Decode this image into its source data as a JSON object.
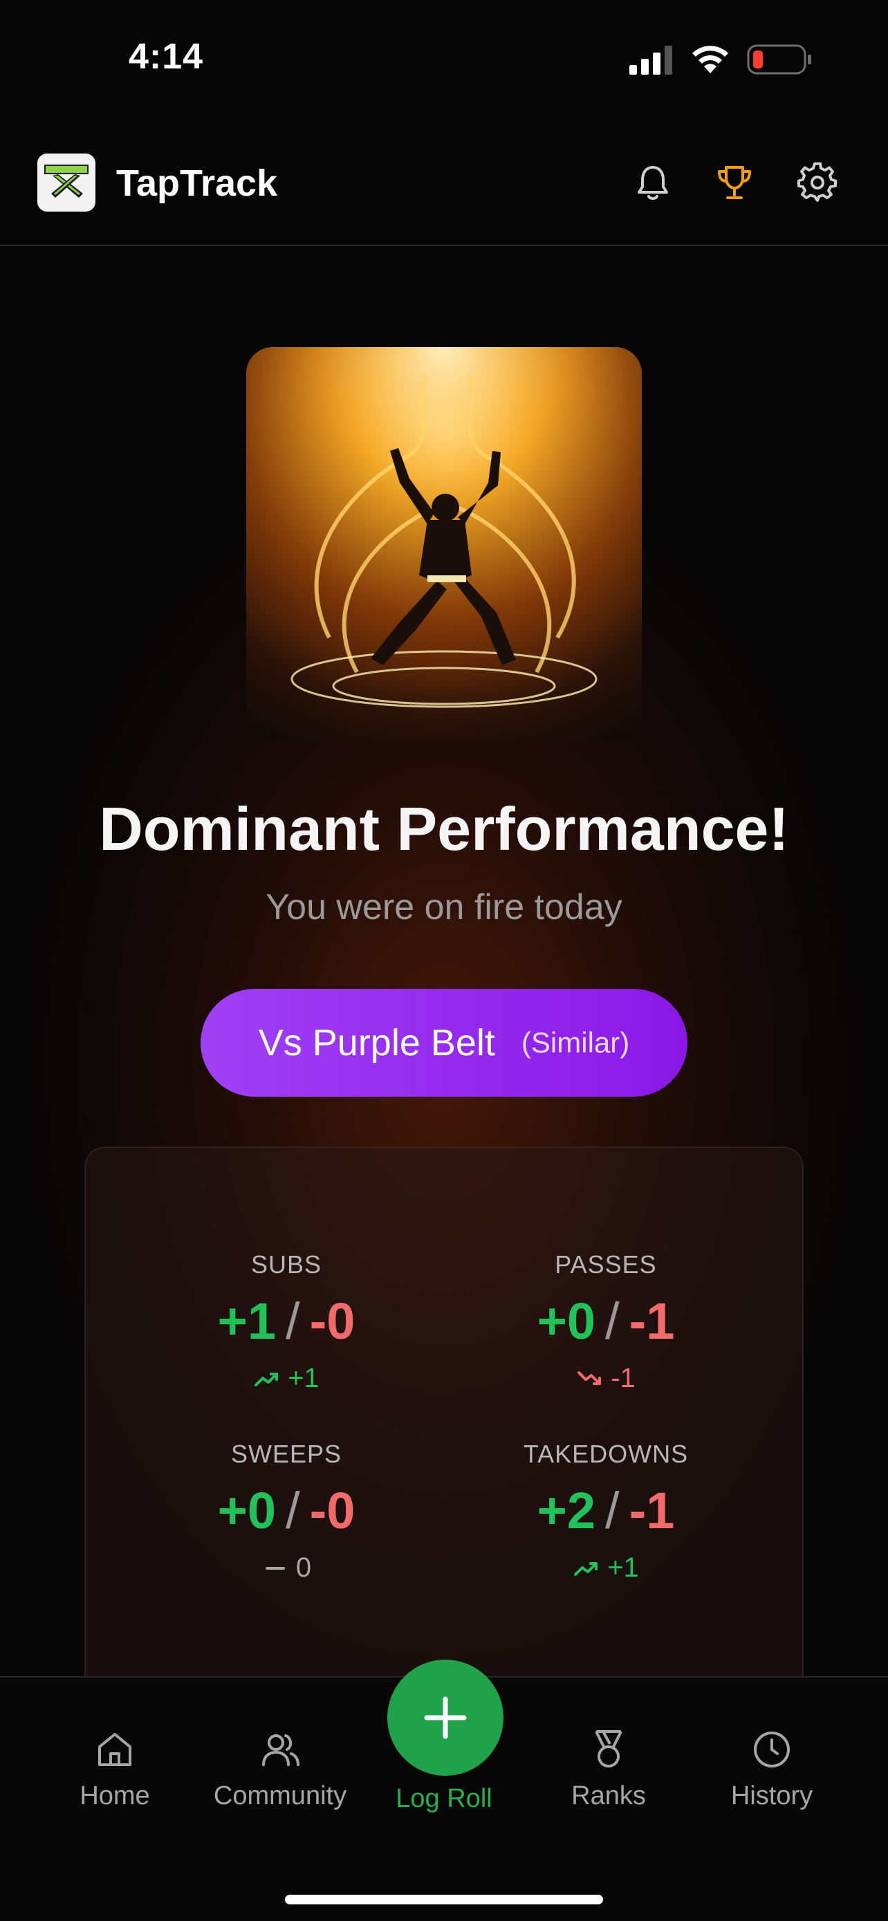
{
  "status_bar": {
    "time": "4:14"
  },
  "header": {
    "app_title": "TapTrack",
    "icons": [
      "bell-icon",
      "trophy-icon",
      "gear-icon"
    ],
    "trophy_color": "#f59e0b"
  },
  "result": {
    "headline": "Dominant Performance!",
    "subline": "You were on fire today"
  },
  "opponent": {
    "label": "Vs Purple Belt",
    "tag": "(Similar)",
    "color": "#9b30f0"
  },
  "stats": [
    {
      "label": "SUBS",
      "won": "+1",
      "lost": "-0",
      "trend": "+1",
      "trend_dir": "up"
    },
    {
      "label": "PASSES",
      "won": "+0",
      "lost": "-1",
      "trend": "-1",
      "trend_dir": "down"
    },
    {
      "label": "SWEEPS",
      "won": "+0",
      "lost": "-0",
      "trend": "0",
      "trend_dir": "flat"
    },
    {
      "label": "TAKEDOWNS",
      "won": "+2",
      "lost": "-1",
      "trend": "+1",
      "trend_dir": "up"
    }
  ],
  "nav": {
    "home": "Home",
    "community": "Community",
    "log_roll": "Log Roll",
    "ranks": "Ranks",
    "history": "History",
    "active_color": "#22b24f"
  }
}
